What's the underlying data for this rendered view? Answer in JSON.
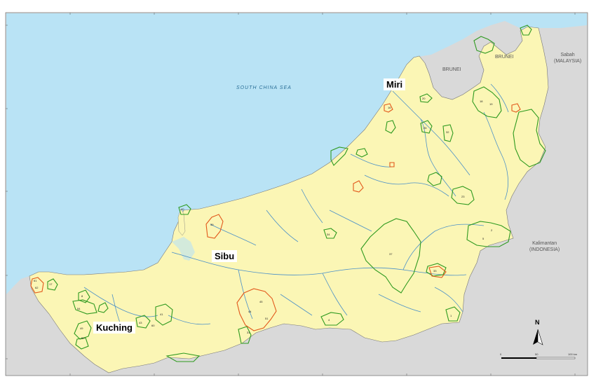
{
  "cities": {
    "miri": "Miri",
    "sibu": "Sibu",
    "kuching": "Kuching"
  },
  "sea": "SOUTH CHINA SEA",
  "countries": {
    "brunei_1": "BRUNEI",
    "brunei_2": "BRUNEI",
    "sabah": "Sabah",
    "sabah_sub": "(MALAYSIA)",
    "kalimantan": "Kalimantan",
    "kalimantan_sub": "(INDONESIA)"
  },
  "north_arrow": "N",
  "scale_bar": {
    "start": "0",
    "mid": "50",
    "end": "100 km"
  },
  "colors": {
    "sea": "#b9e3f5",
    "land_sarawak": "#fbf6b5",
    "land_other": "#d9d9d9",
    "river": "#4a90c8",
    "protected_green": "#2e9a1f",
    "protected_orange": "#e2581b"
  },
  "area_numbers": [
    "20",
    "16",
    "18",
    "19",
    "2",
    "5",
    "37",
    "23",
    "33",
    "34",
    "26",
    "32",
    "39",
    "40",
    "44",
    "45",
    "51",
    "31",
    "1",
    "4",
    "17",
    "61",
    "62",
    "8",
    "54",
    "49",
    "50",
    "41",
    "43",
    "60"
  ]
}
